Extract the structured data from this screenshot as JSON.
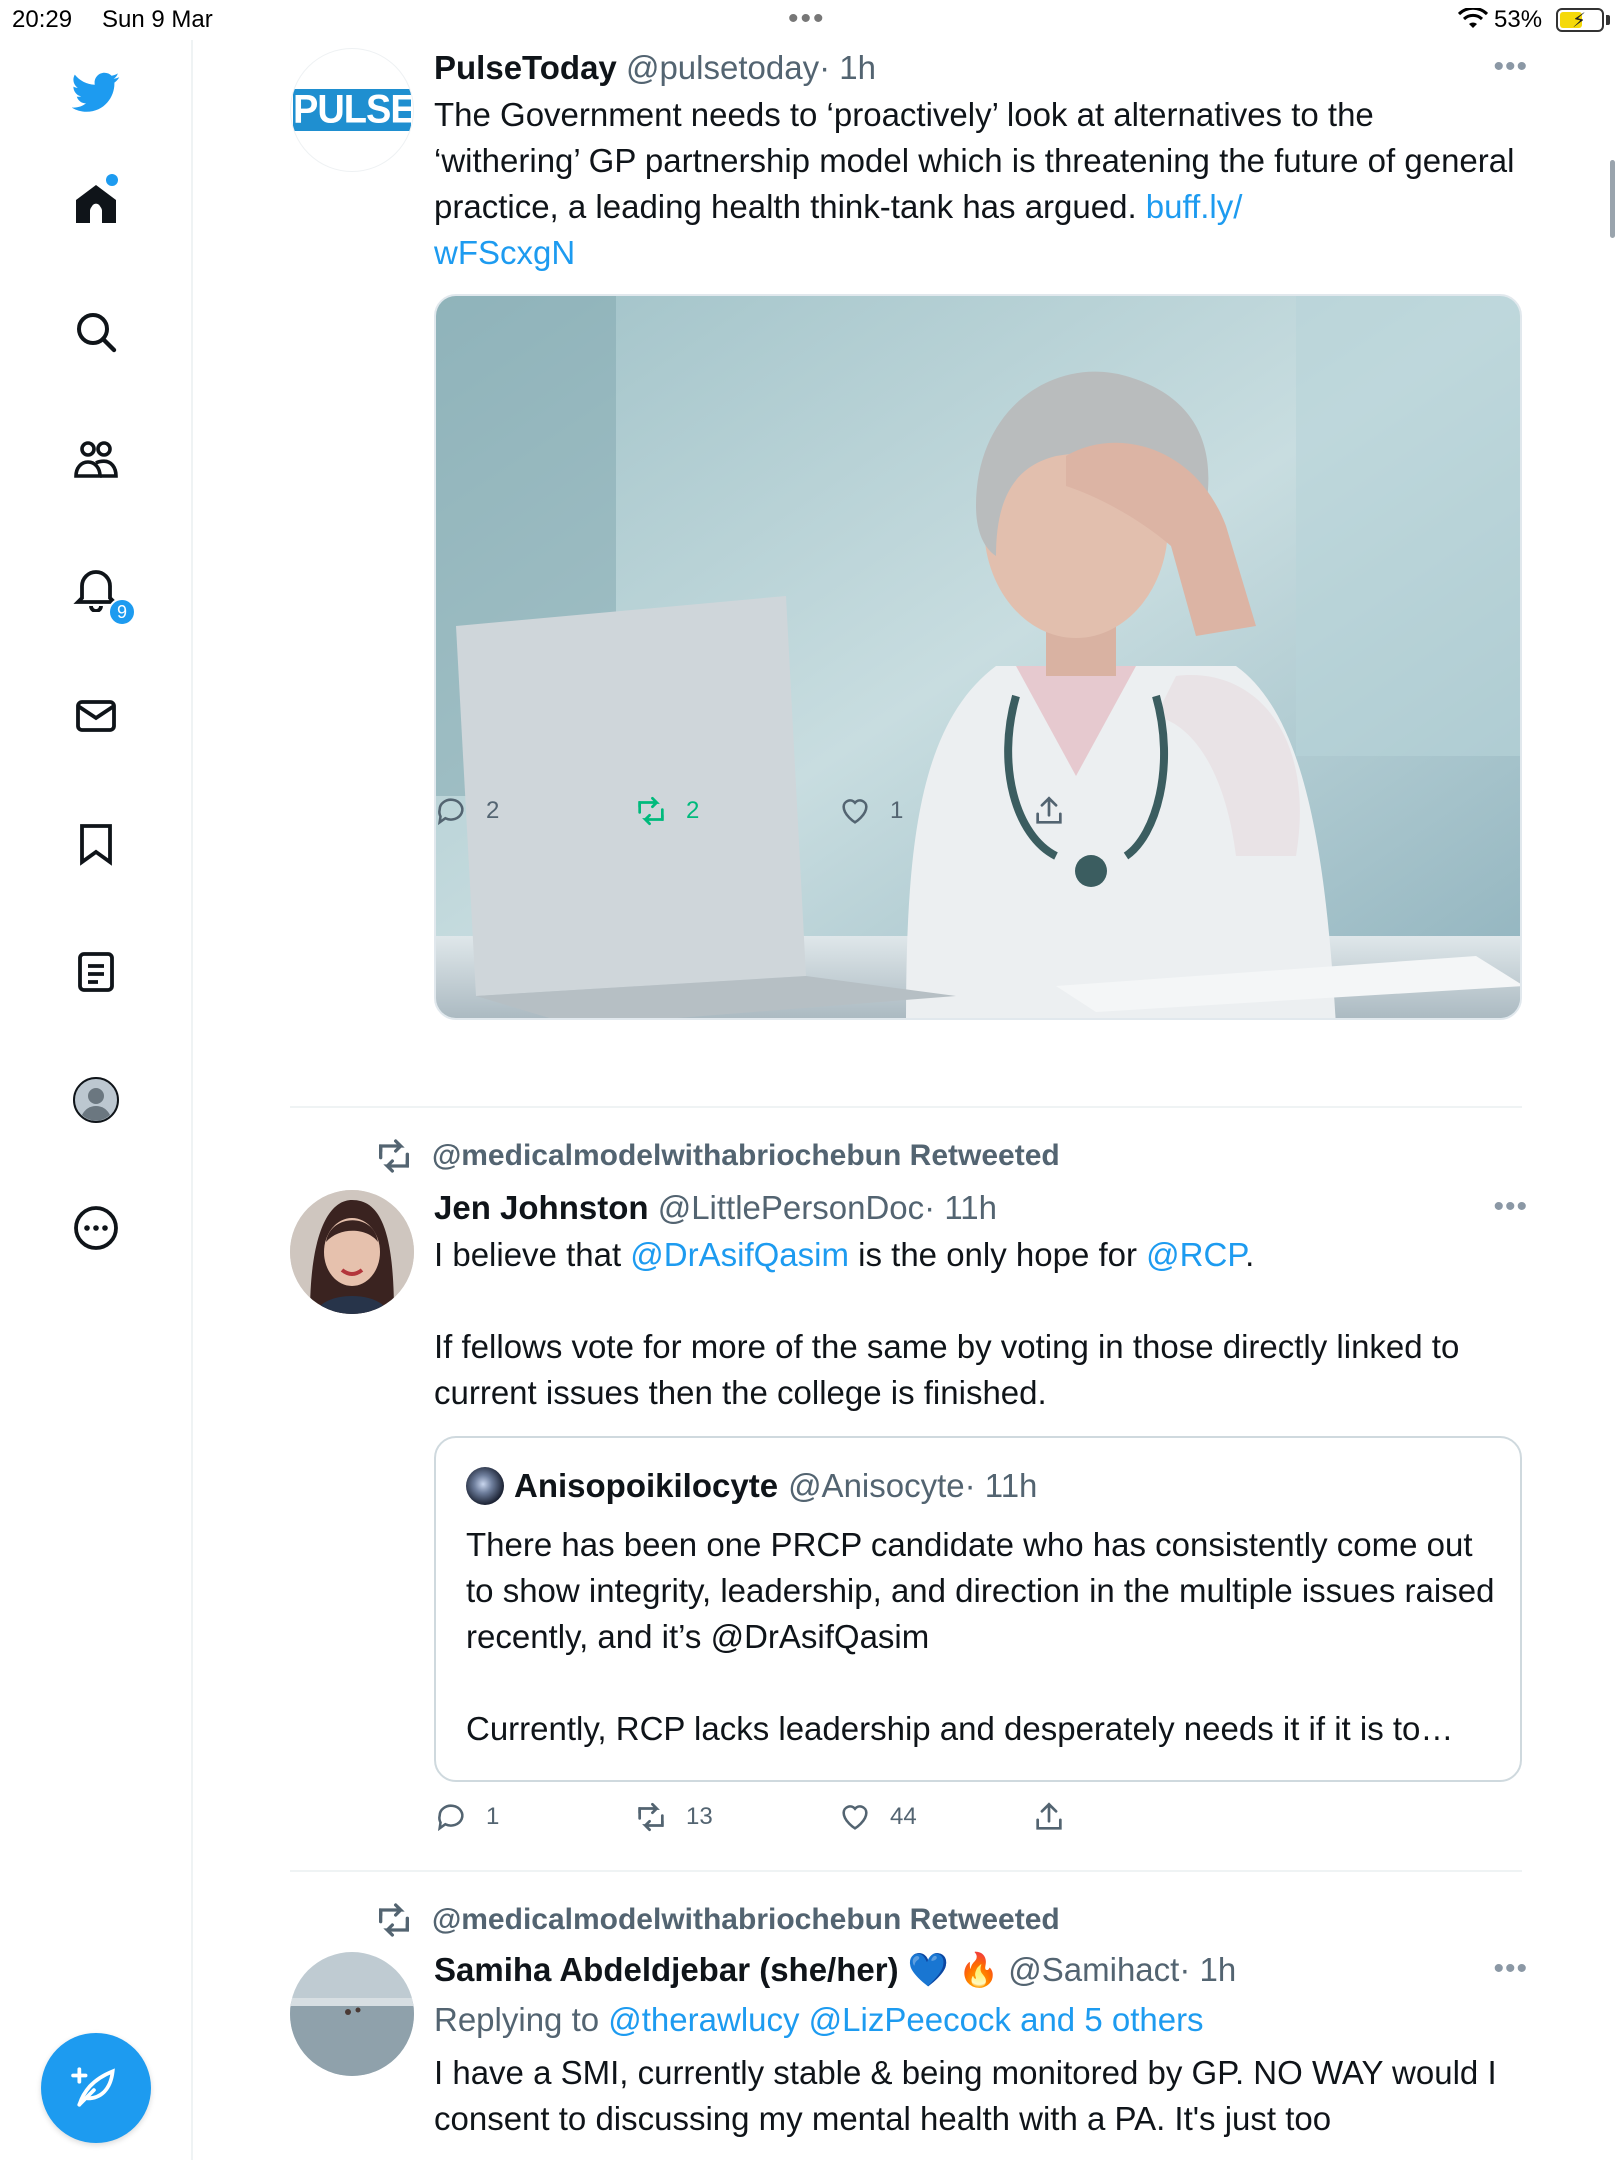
{
  "status_bar": {
    "time": "20:29",
    "date": "Sun 9 Mar",
    "battery": "53%"
  },
  "sidebar": {
    "notification_count": "9",
    "items": [
      "twitter-logo",
      "home-icon",
      "search-icon",
      "communities-icon",
      "notifications-icon",
      "messages-icon",
      "bookmarks-icon",
      "lists-icon",
      "profile-icon",
      "more-icon"
    ]
  },
  "tweets": [
    {
      "name": "PulseToday",
      "handle": "@pulsetoday",
      "time": "· 1h",
      "avatar_text": "PULSE",
      "text": "The Government needs to ‘proactively’ look at alternatives to the ‘withering’ GP partnership model which is threatening the future of general practice, a leading health think-tank has argued. ",
      "link": "buff.ly/\nwFScxgN",
      "replies": "2",
      "retweets": "2",
      "likes": "1",
      "retweet_color": "#00ba7c"
    },
    {
      "retweeted_by": "@medicalmodelwithabriochebun Retweeted",
      "name": "Jen Johnston",
      "handle": "@LittlePersonDoc",
      "time": "· 11h",
      "text_parts": [
        "I believe that ",
        "@DrAsifQasim",
        " is the only hope for ",
        "@RCP",
        "."
      ],
      "text2": "If fellows vote for more of the same by voting in those directly linked to current issues then the college is finished.",
      "quote": {
        "name": "Anisopoikilocyte",
        "handle": "@Anisocyte",
        "time": "· 11h",
        "text": "There has been one PRCP candidate who has consistently come out to show integrity, leadership, and direction in the multiple issues raised recently, and it’s @DrAsifQasim",
        "text2": "Currently, RCP lacks leadership and desperately needs it if it is to…"
      },
      "replies": "1",
      "retweets": "13",
      "likes": "44"
    },
    {
      "retweeted_by": "@medicalmodelwithabriochebun Retweeted",
      "name": "Samiha Abdeldjebar (she/her)",
      "emoji": "💙 🔥",
      "handle": "@Samihact",
      "time": "· 1h",
      "replying_prefix": "Replying to ",
      "replying_to": "@therawlucy @LizPeecock and 5 others",
      "text": "I have a SMI, currently stable & being monitored by GP. NO WAY would I consent to discussing my mental health with a PA. It's just too"
    }
  ],
  "colors": {
    "accent": "#1d9bf0",
    "secondary_text": "#536471",
    "divider": "#eff3f4"
  }
}
